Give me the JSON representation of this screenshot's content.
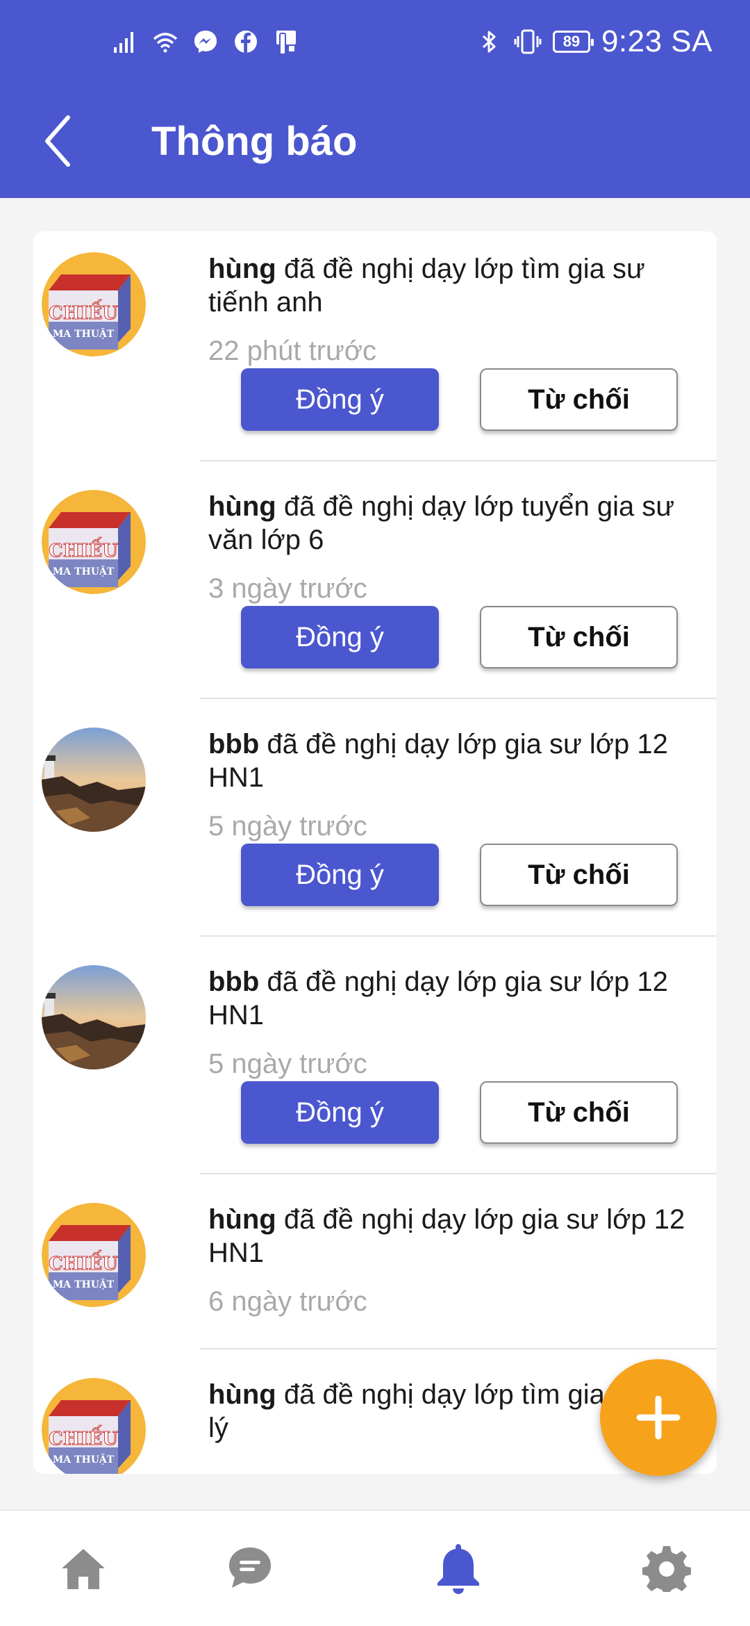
{
  "status_bar": {
    "time": "9:23 SA",
    "battery": "89",
    "left_icons": [
      "signal-icon",
      "wifi-icon",
      "messenger-icon",
      "facebook-icon",
      "phone-icon"
    ],
    "right_icons": [
      "bluetooth-icon",
      "vibrate-icon",
      "battery-icon"
    ]
  },
  "header": {
    "title": "Thông báo",
    "back_icon": "chevron-left-icon"
  },
  "notifications": [
    {
      "user": "hùng",
      "text": " đã đề nghị dạy lớp tìm gia sư tiếnh anh",
      "time": "22 phút trước",
      "avatar": "chieu-ma-thuat",
      "accept_label": "Đồng ý",
      "reject_label": "Từ chối"
    },
    {
      "user": "hùng",
      "text": " đã đề nghị dạy lớp tuyển gia sư văn lớp 6",
      "time": "3 ngày trước",
      "avatar": "chieu-ma-thuat",
      "accept_label": "Đồng ý",
      "reject_label": "Từ chối"
    },
    {
      "user": "bbb",
      "text": " đã đề nghị dạy lớp gia sư lớp 12 HN1",
      "time": "5 ngày trước",
      "avatar": "lighthouse",
      "accept_label": "Đồng ý",
      "reject_label": "Từ chối"
    },
    {
      "user": "bbb",
      "text": " đã đề nghị dạy lớp gia sư lớp 12 HN1",
      "time": "5 ngày trước",
      "avatar": "lighthouse",
      "accept_label": "Đồng ý",
      "reject_label": "Từ chối"
    },
    {
      "user": "hùng",
      "text": " đã đề nghị dạy lớp gia sư lớp 12 HN1",
      "time": "6 ngày trước",
      "avatar": "chieu-ma-thuat"
    },
    {
      "user": "hùng",
      "text": " đã đề nghị dạy lớp tìm gia",
      "text_2": "lý",
      "avatar": "chieu-ma-thuat"
    }
  ],
  "avatar_logo": {
    "line1": "CHIẾU",
    "line2": "MA THUẬT"
  },
  "fab": {
    "icon": "plus-icon"
  },
  "bottom_nav": [
    {
      "icon": "home-icon",
      "active": false
    },
    {
      "icon": "chat-icon",
      "active": false
    },
    {
      "icon": "bell-icon",
      "active": true
    },
    {
      "icon": "gear-icon",
      "active": false
    }
  ],
  "colors": {
    "primary": "#4b57cf",
    "fab": "#f7a21b",
    "muted_text": "#a9a9a9",
    "nav_inactive": "#8c8c8c"
  }
}
